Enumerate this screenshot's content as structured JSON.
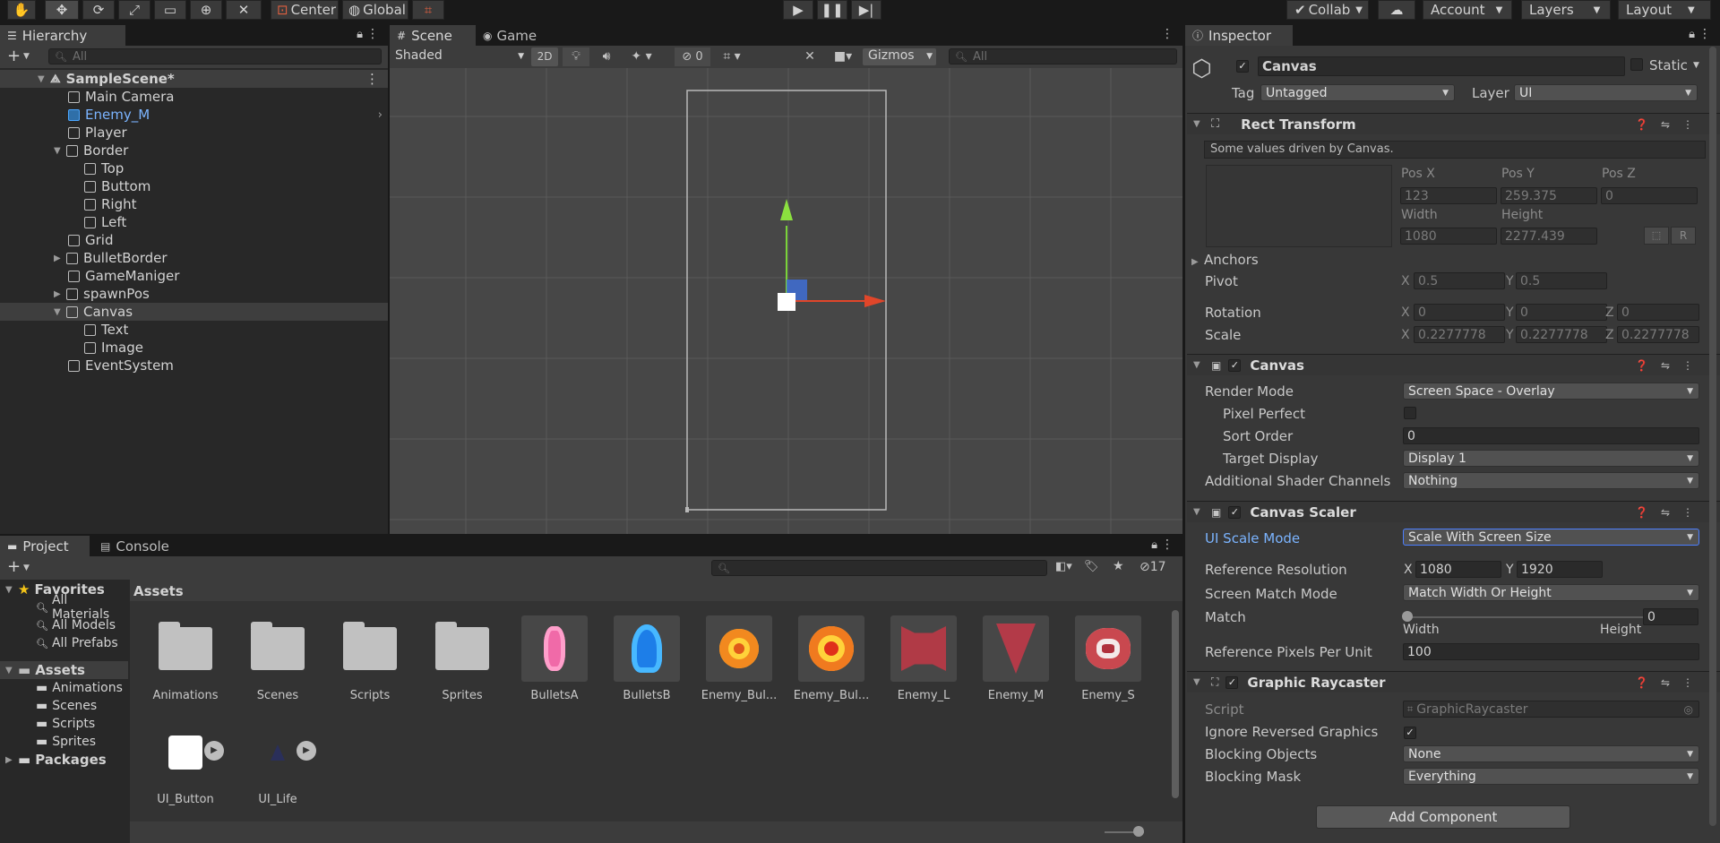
{
  "toolbar": {
    "pivot_label": "Center",
    "space_label": "Global",
    "collab_label": "Collab",
    "account_label": "Account",
    "layers_label": "Layers",
    "layout_label": "Layout"
  },
  "hierarchy": {
    "tab": "Hierarchy",
    "search_placeholder": "All",
    "scene": "SampleScene*",
    "items": [
      {
        "label": "Main Camera"
      },
      {
        "label": "Enemy_M"
      },
      {
        "label": "Player"
      },
      {
        "label": "Border"
      },
      {
        "label": "Top"
      },
      {
        "label": "Buttom"
      },
      {
        "label": "Right"
      },
      {
        "label": "Left"
      },
      {
        "label": "Grid"
      },
      {
        "label": "BulletBorder"
      },
      {
        "label": "GameManiger"
      },
      {
        "label": "spawnPos"
      },
      {
        "label": "Canvas"
      },
      {
        "label": "Text"
      },
      {
        "label": "Image"
      },
      {
        "label": "EventSystem"
      }
    ]
  },
  "scene": {
    "tab_scene": "Scene",
    "tab_game": "Game",
    "shading": "Shaded",
    "mode_2d": "2D",
    "hidden_count": "0",
    "gizmos": "Gizmos",
    "search_placeholder": "All"
  },
  "project": {
    "tab_project": "Project",
    "tab_console": "Console",
    "hidden_count": "17",
    "favorites": "Favorites",
    "fav_items": [
      "All Materials",
      "All Models",
      "All Prefabs"
    ],
    "assets_root": "Assets",
    "asset_folders": [
      "Animations",
      "Scenes",
      "Scripts",
      "Sprites"
    ],
    "packages": "Packages",
    "breadcrumb": "Assets",
    "assets": [
      {
        "label": "Animations"
      },
      {
        "label": "Scenes"
      },
      {
        "label": "Scripts"
      },
      {
        "label": "Sprites"
      },
      {
        "label": "BulletsA"
      },
      {
        "label": "BulletsB"
      },
      {
        "label": "Enemy_Bul..."
      },
      {
        "label": "Enemy_Bul..."
      },
      {
        "label": "Enemy_L"
      },
      {
        "label": "Enemy_M"
      },
      {
        "label": "Enemy_S"
      },
      {
        "label": "UI_Button"
      },
      {
        "label": "UI_Life"
      }
    ]
  },
  "inspector": {
    "tab": "Inspector",
    "object_name": "Canvas",
    "static_label": "Static",
    "tag_label": "Tag",
    "tag_value": "Untagged",
    "layer_label": "Layer",
    "layer_value": "UI",
    "rect": {
      "title": "Rect Transform",
      "note": "Some values driven by Canvas.",
      "posx_label": "Pos X",
      "posy_label": "Pos Y",
      "posz_label": "Pos Z",
      "posx": "123",
      "posy": "259.375",
      "posz": "0",
      "width_label": "Width",
      "height_label": "Height",
      "width": "1080",
      "height": "2277.439",
      "anchors": "Anchors",
      "pivot": "Pivot",
      "pivot_x": "0.5",
      "pivot_y": "0.5",
      "rotation": "Rotation",
      "rot_x": "0",
      "rot_y": "0",
      "rot_z": "0",
      "scale": "Scale",
      "scale_x": "0.2277778",
      "scale_y": "0.2277778",
      "scale_z": "0.2277778",
      "r_btn": "R"
    },
    "canvas": {
      "title": "Canvas",
      "render_mode_label": "Render Mode",
      "render_mode": "Screen Space - Overlay",
      "pixel_perfect_label": "Pixel Perfect",
      "sort_order_label": "Sort Order",
      "sort_order": "0",
      "target_display_label": "Target Display",
      "target_display": "Display 1",
      "shader_channels_label": "Additional Shader Channels",
      "shader_channels": "Nothing"
    },
    "scaler": {
      "title": "Canvas Scaler",
      "ui_scale_label": "UI Scale Mode",
      "ui_scale": "Scale With Screen Size",
      "ref_res_label": "Reference Resolution",
      "ref_x": "1080",
      "ref_y": "1920",
      "match_mode_label": "Screen Match Mode",
      "match_mode": "Match Width Or Height",
      "match_label": "Match",
      "match_value": "0",
      "match_fraction": 0,
      "width_lbl": "Width",
      "height_lbl": "Height",
      "ppu_label": "Reference Pixels Per Unit",
      "ppu": "100"
    },
    "raycaster": {
      "title": "Graphic Raycaster",
      "script_label": "Script",
      "script": "GraphicRaycaster",
      "ignore_label": "Ignore Reversed Graphics",
      "blocking_objects_label": "Blocking Objects",
      "blocking_objects": "None",
      "blocking_mask_label": "Blocking Mask",
      "blocking_mask": "Everything"
    },
    "add_component": "Add Component"
  },
  "colors": {
    "accent": "#4c7fff",
    "selection": "#2c5d87",
    "link": "#7bb4ff"
  }
}
